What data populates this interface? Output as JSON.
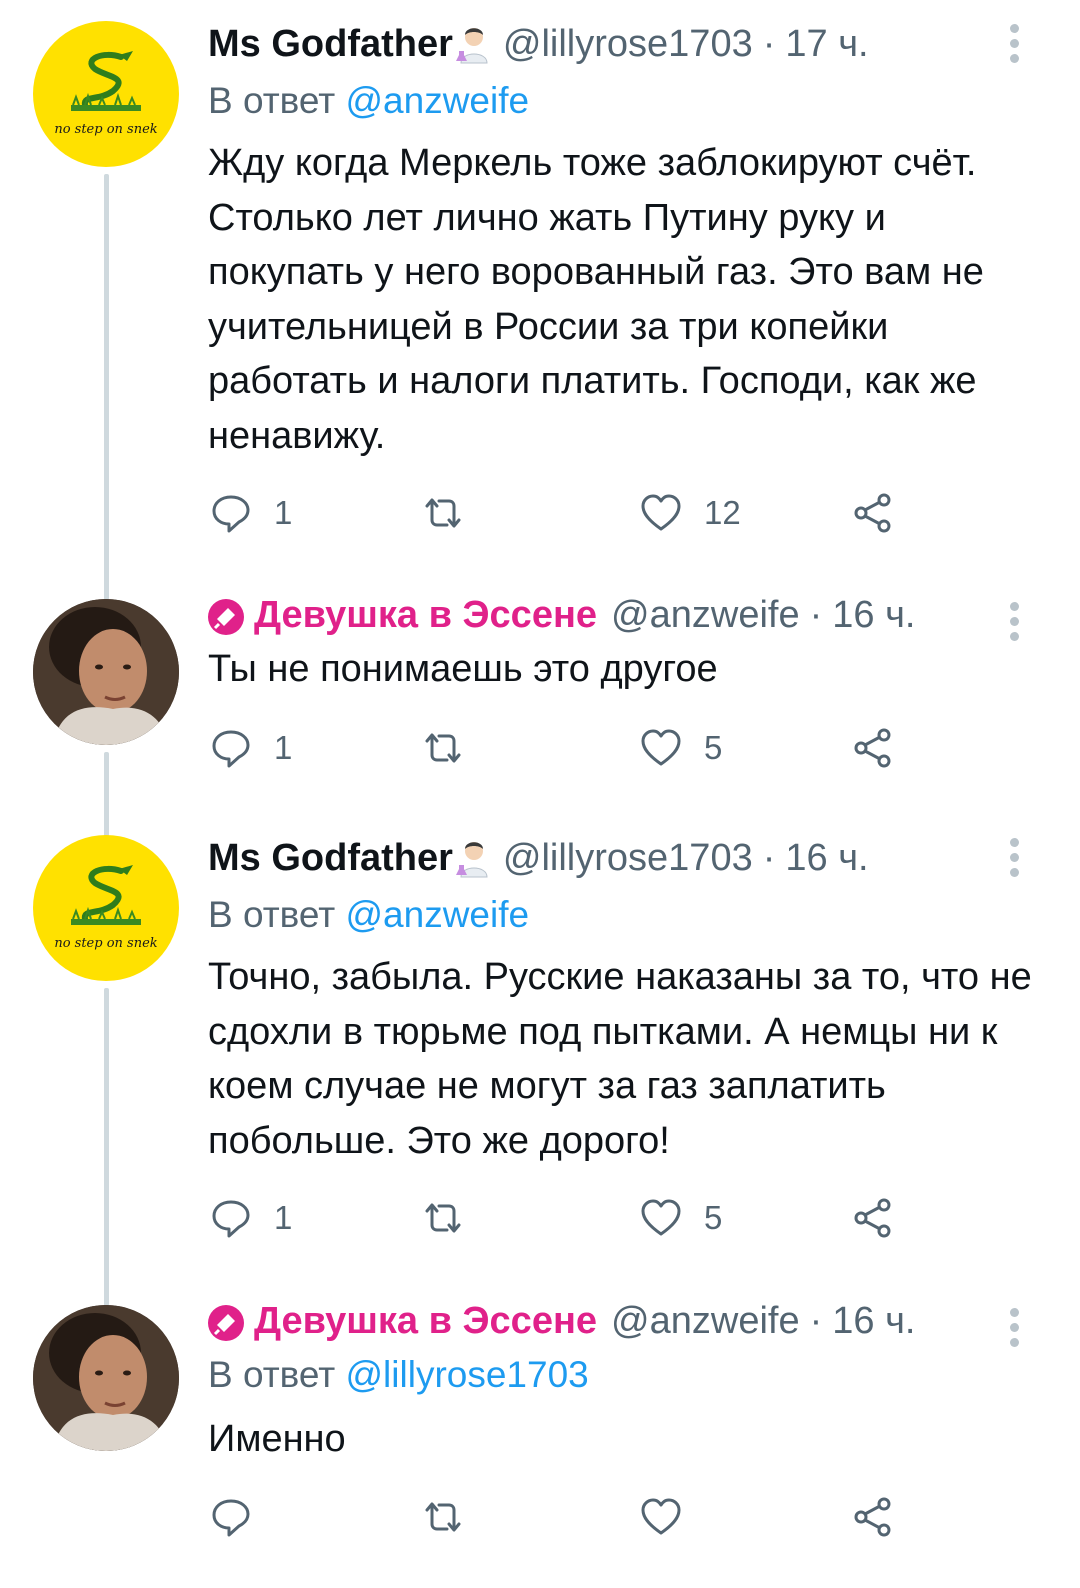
{
  "tweets": [
    {
      "author": "Ms Godfather",
      "handle": "@lillyrose1703",
      "time": "17 ч.",
      "reply_prefix": "В ответ",
      "reply_to": "@anzweife",
      "text": "Жду когда Меркель тоже заблокируют счёт. Столько лет лично жать Путину руку и покупать у него ворованный газ. Это вам не учительницей в России за три копейки работать и налоги платить. Господи, как же ненавижу.",
      "replies": "1",
      "retweets": "",
      "likes": "12",
      "avatar_caption": "no step on snek"
    },
    {
      "author": "Девушка в Эссене",
      "handle": "@anzweife",
      "time": "16 ч.",
      "text": "Ты не понимаешь это другое",
      "replies": "1",
      "retweets": "",
      "likes": "5"
    },
    {
      "author": "Ms Godfather",
      "handle": "@lillyrose1703",
      "time": "16 ч.",
      "reply_prefix": "В ответ",
      "reply_to": "@anzweife",
      "text": "Точно, забыла. Русские наказаны за то, что не сдохли в тюрьме под пытками. А немцы ни к коем случае не могут за газ заплатить побольше. Это же дорого!",
      "replies": "1",
      "retweets": "",
      "likes": "5",
      "avatar_caption": "no step on snek"
    },
    {
      "author": "Девушка в Эссене",
      "handle": "@anzweife",
      "time": "16 ч.",
      "reply_prefix": "В ответ",
      "reply_to": "@lillyrose1703",
      "text": "Именно",
      "replies": "",
      "retweets": "",
      "likes": ""
    }
  ],
  "separator": "·",
  "colors": {
    "accent": "#1d9bf0",
    "pink_name": "#e0218a",
    "muted": "#536471",
    "thread_line": "#cfd9de",
    "snek_bg": "#ffe100"
  },
  "icons": [
    "reply-icon",
    "retweet-icon",
    "like-icon",
    "share-icon",
    "more-options-icon",
    "scientist-emoji-icon",
    "microphone-icon"
  ]
}
